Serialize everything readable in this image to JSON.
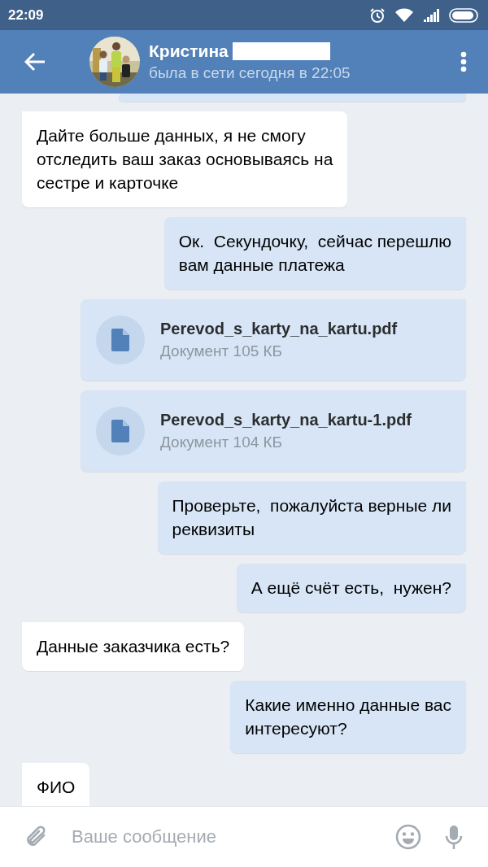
{
  "status_bar": {
    "time": "22:09"
  },
  "header": {
    "name": "Кристина",
    "name_redacted": true,
    "last_seen": "была в сети сегодня в 22:05"
  },
  "messages": [
    {
      "kind": "clipped",
      "outgoing": true
    },
    {
      "kind": "text",
      "outgoing": false,
      "text": "Дайте больше данных, я не смогу\nотследить ваш заказ основываясь на\nсестре и карточке"
    },
    {
      "kind": "text",
      "outgoing": true,
      "text": "Ок.  Секундочку,  сейчас перешлю\nвам данные платежа"
    },
    {
      "kind": "file",
      "outgoing": true,
      "name": "Perevod_s_karty_na_kartu.pdf",
      "meta": "Документ 105 КБ"
    },
    {
      "kind": "file",
      "outgoing": true,
      "name": "Perevod_s_karty_na_kartu-1.pdf",
      "meta": "Документ 104 КБ"
    },
    {
      "kind": "text",
      "outgoing": true,
      "text": "Проверьте,  пожалуйста верные ли\nреквизиты"
    },
    {
      "kind": "text",
      "outgoing": true,
      "text": "А ещё счёт есть,  нужен?"
    },
    {
      "kind": "text",
      "outgoing": false,
      "text": "Данные заказчика есть?"
    },
    {
      "kind": "text",
      "outgoing": true,
      "text": "Какие именно данные вас\nинтересуют?"
    },
    {
      "kind": "text",
      "outgoing": false,
      "text": "ФИО"
    }
  ],
  "composer": {
    "placeholder": "Ваше сообщение"
  }
}
